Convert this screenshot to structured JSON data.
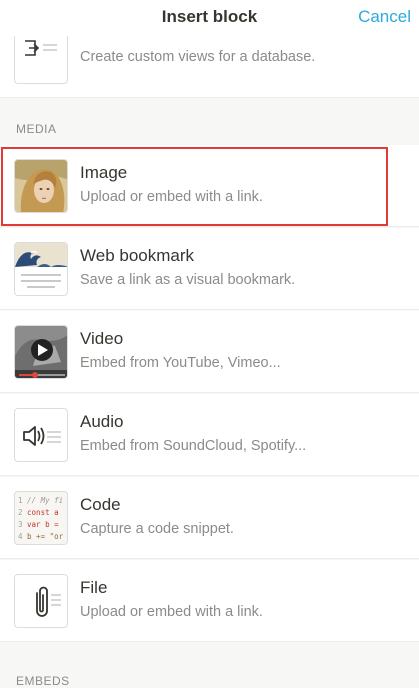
{
  "header": {
    "title": "Insert block",
    "cancel_label": "Cancel"
  },
  "top_item": {
    "subtitle": "Create custom views for a database.",
    "icon": "linked-database-icon"
  },
  "media_section": {
    "heading": "MEDIA"
  },
  "items": [
    {
      "title": "Image",
      "subtitle": "Upload or embed with a link.",
      "icon": "image-thumbnail"
    },
    {
      "title": "Web bookmark",
      "subtitle": "Save a link as a visual bookmark.",
      "icon": "bookmark-thumbnail"
    },
    {
      "title": "Video",
      "subtitle": "Embed from YouTube, Vimeo...",
      "icon": "video-thumbnail"
    },
    {
      "title": "Audio",
      "subtitle": "Embed from SoundCloud, Spotify...",
      "icon": "audio-icon"
    },
    {
      "title": "Code",
      "subtitle": "Capture a code snippet.",
      "icon": "code-thumbnail",
      "snippet": [
        {
          "n": "1",
          "code": "// My fi"
        },
        {
          "n": "2",
          "code": "const a"
        },
        {
          "n": "3",
          "code": "var b ="
        },
        {
          "n": "4",
          "code": "b += \"or"
        }
      ]
    },
    {
      "title": "File",
      "subtitle": "Upload or embed with a link.",
      "icon": "paperclip-icon"
    }
  ],
  "next_section": {
    "heading": "EMBEDS"
  },
  "colors": {
    "accent": "#2eaadc",
    "highlight": "#e53935"
  }
}
